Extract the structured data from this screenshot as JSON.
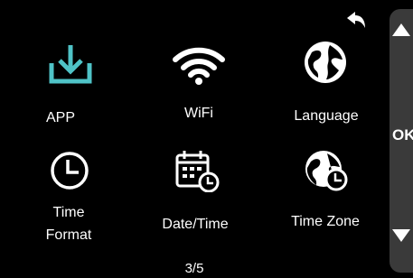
{
  "menu": {
    "items": [
      {
        "label": "APP",
        "icon": "download-icon",
        "color": "#4fc3c7"
      },
      {
        "label": "WiFi",
        "icon": "wifi-icon"
      },
      {
        "label": "Language",
        "icon": "globe-icon"
      },
      {
        "label_line1": "Time",
        "label_line2": "Format",
        "icon": "clock-icon"
      },
      {
        "label": "Date/Time",
        "icon": "calendar-icon"
      },
      {
        "label": "Time Zone",
        "icon": "globe-clock-icon"
      }
    ],
    "page_indicator": "3/5"
  },
  "side": {
    "up_icon": "triangle-up-icon",
    "ok_label": "OK",
    "down_icon": "triangle-down-icon"
  },
  "back_icon": "back-arrow-icon"
}
